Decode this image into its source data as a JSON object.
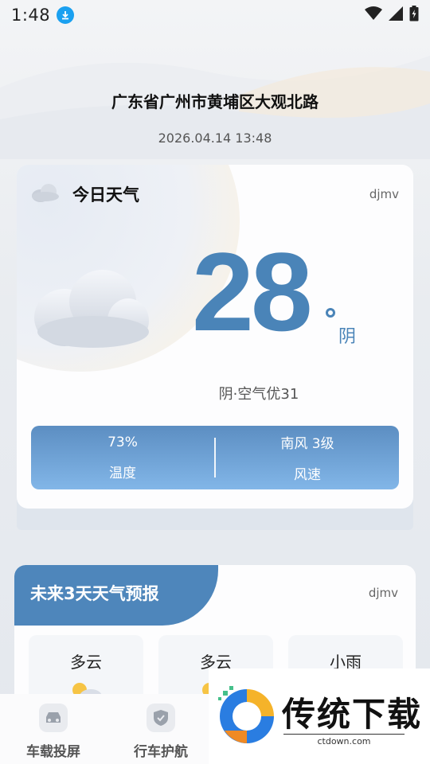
{
  "status": {
    "time": "1:48"
  },
  "header": {
    "location": "广东省广州市黄埔区大观北路",
    "datetime": "2026.04.14 13:48"
  },
  "today": {
    "title": "今日天气",
    "tag": "djmv",
    "temperature": "28",
    "condition": "阴",
    "air_quality": "阴·空气优31",
    "humidity_value": "73%",
    "humidity_label": "温度",
    "wind_value": "南风 3级",
    "wind_label": "风速"
  },
  "forecast": {
    "title": "未来3天天气预报",
    "tag": "djmv",
    "days": [
      {
        "label": "多云"
      },
      {
        "label": "多云"
      },
      {
        "label": "小雨"
      }
    ]
  },
  "bottom_nav": {
    "items": [
      {
        "label": "车载投屏",
        "icon": "car-icon"
      },
      {
        "label": "行车护航",
        "icon": "shield-icon"
      }
    ]
  },
  "watermark": {
    "text": "传统下载",
    "sub": "ctdown.com"
  },
  "colors": {
    "accent": "#4a84b8",
    "stats_top": "#5c8ec2",
    "stats_bottom": "#82b6e8"
  }
}
